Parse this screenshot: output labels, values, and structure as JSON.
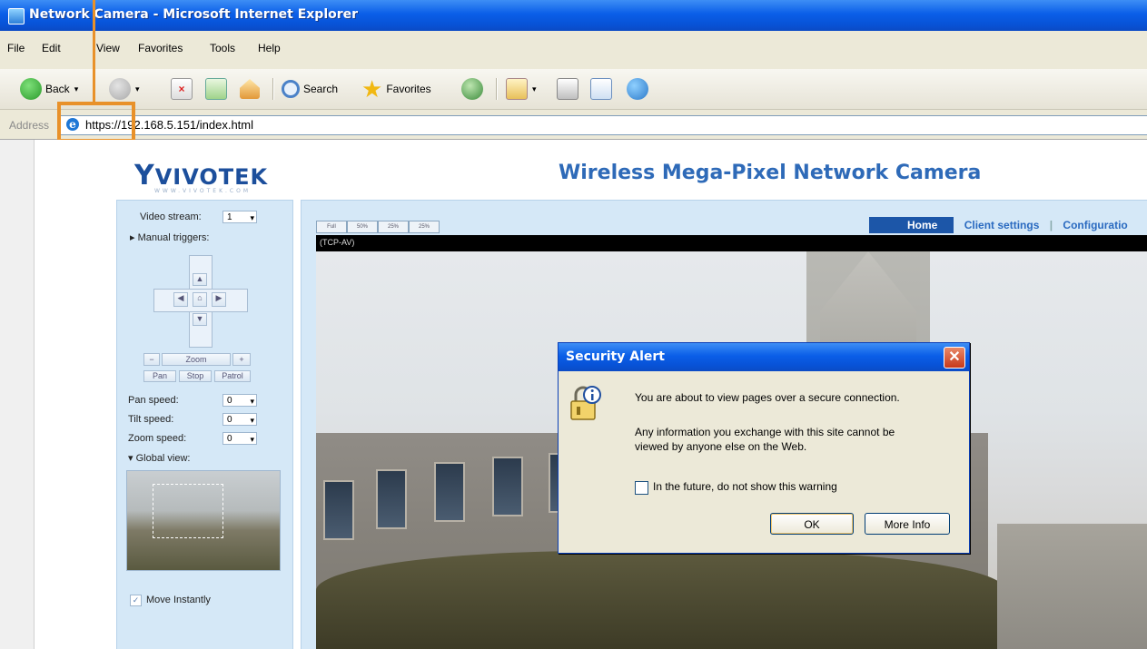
{
  "window": {
    "title": "Network Camera - Microsoft Internet Explorer"
  },
  "menu": [
    "File",
    "Edit",
    "View",
    "Favorites",
    "Tools",
    "Help"
  ],
  "toolbar": {
    "back": "Back",
    "search": "Search",
    "favorites": "Favorites"
  },
  "address": {
    "label": "Address",
    "url": "https://192.168.5.151/index.html"
  },
  "page": {
    "logo": "VIVOTEK",
    "logo_sub": "WWW.VIVOTEK.COM",
    "title": "Wireless Mega-Pixel Network Camera",
    "nav": {
      "home": "Home",
      "client_settings": "Client settings",
      "configuration": "Configuratio"
    },
    "video_label": "(TCP-AV)",
    "video_sizes": [
      "Full",
      "50%",
      "25%",
      "25%"
    ]
  },
  "controls": {
    "video_stream_label": "Video stream:",
    "video_stream_value": "1",
    "manual_triggers": "Manual triggers:",
    "zoom": "Zoom",
    "zoom_minus": "−",
    "zoom_plus": "+",
    "pan": "Pan",
    "stop": "Stop",
    "patrol": "Patrol",
    "pan_speed_label": "Pan speed:",
    "pan_speed_value": "0",
    "tilt_speed_label": "Tilt speed:",
    "tilt_speed_value": "0",
    "zoom_speed_label": "Zoom speed:",
    "zoom_speed_value": "0",
    "global_view": "Global view:",
    "move_instantly": "Move Instantly"
  },
  "dialog": {
    "title": "Security Alert",
    "line1": "You are about to view pages over a secure connection.",
    "line2": "Any information you exchange with this site cannot be",
    "line3": "viewed by anyone else on the Web.",
    "checkbox_label": "In the future, do not show this warning",
    "ok": "OK",
    "more_info": "More Info"
  },
  "colors": {
    "xp_blue": "#0a5ee8",
    "callout": "#e8912a",
    "panel": "#d5e8f7",
    "nav_home": "#1c56a8"
  }
}
